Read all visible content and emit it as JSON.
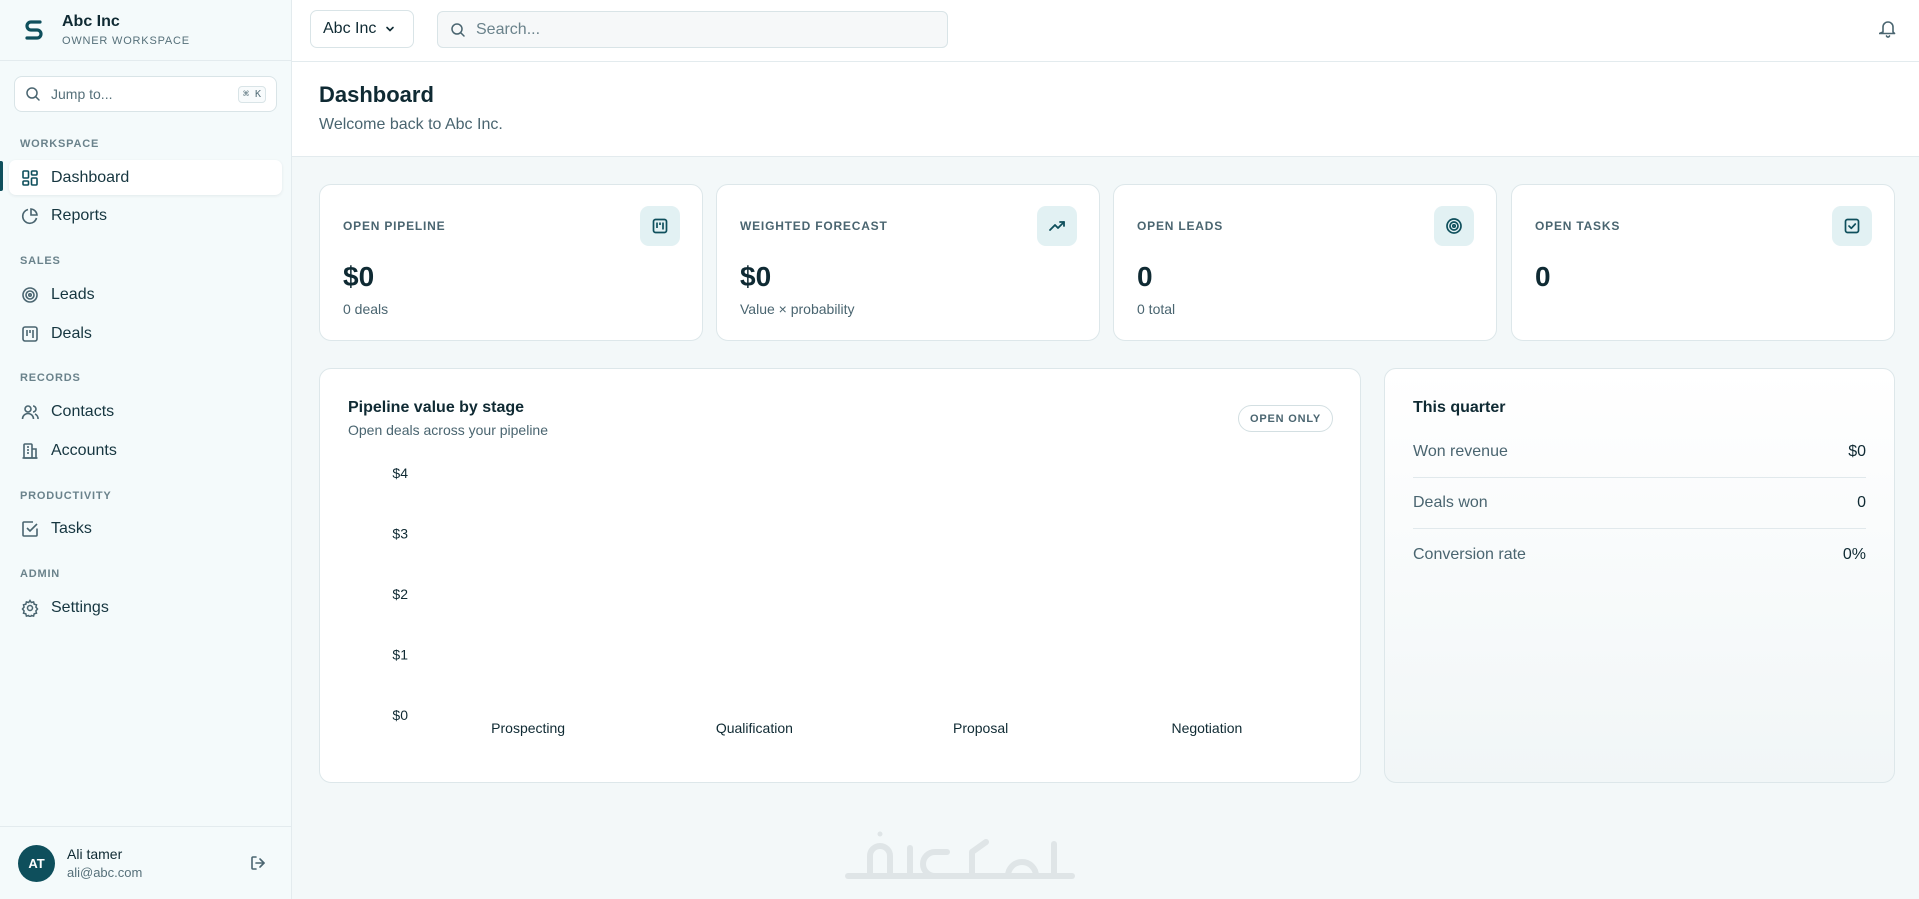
{
  "brand": {
    "name": "Abc Inc",
    "subtitle": "OWNER WORKSPACE"
  },
  "jump": {
    "placeholder": "Jump to...",
    "shortcut": "⌘ K"
  },
  "sidebar": {
    "sections": [
      {
        "label": "WORKSPACE",
        "items": [
          {
            "label": "Dashboard",
            "icon": "dashboard-icon",
            "active": true
          },
          {
            "label": "Reports",
            "icon": "pie-chart-icon"
          }
        ]
      },
      {
        "label": "SALES",
        "items": [
          {
            "label": "Leads",
            "icon": "target-icon"
          },
          {
            "label": "Deals",
            "icon": "kanban-icon"
          }
        ]
      },
      {
        "label": "RECORDS",
        "items": [
          {
            "label": "Contacts",
            "icon": "users-icon"
          },
          {
            "label": "Accounts",
            "icon": "building-icon"
          }
        ]
      },
      {
        "label": "PRODUCTIVITY",
        "items": [
          {
            "label": "Tasks",
            "icon": "checkbox-icon"
          }
        ]
      },
      {
        "label": "ADMIN",
        "items": [
          {
            "label": "Settings",
            "icon": "gear-icon"
          }
        ]
      }
    ]
  },
  "user": {
    "initials": "AT",
    "name": "Ali tamer",
    "email": "ali@abc.com"
  },
  "topbar": {
    "org": "Abc Inc",
    "search_placeholder": "Search..."
  },
  "page": {
    "title": "Dashboard",
    "subtitle": "Welcome back to Abc Inc."
  },
  "stats": [
    {
      "label": "OPEN PIPELINE",
      "value": "$0",
      "sub": "0 deals",
      "icon": "kanban-icon"
    },
    {
      "label": "WEIGHTED FORECAST",
      "value": "$0",
      "sub": "Value × probability",
      "icon": "trending-up-icon"
    },
    {
      "label": "OPEN LEADS",
      "value": "0",
      "sub": "0 total",
      "icon": "target-icon"
    },
    {
      "label": "OPEN TASKS",
      "value": "0",
      "sub": "",
      "icon": "checkbox-icon"
    }
  ],
  "pipeline_card": {
    "title": "Pipeline value by stage",
    "subtitle": "Open deals across your pipeline",
    "badge": "OPEN ONLY"
  },
  "chart_data": {
    "type": "bar",
    "categories": [
      "Prospecting",
      "Qualification",
      "Proposal",
      "Negotiation"
    ],
    "values": [
      0,
      0,
      0,
      0
    ],
    "y_ticks": [
      "$0",
      "$1",
      "$2",
      "$3",
      "$4"
    ],
    "ylim": [
      0,
      4
    ],
    "grid": false
  },
  "quarter": {
    "title": "This quarter",
    "rows": [
      {
        "label": "Won revenue",
        "value": "$0"
      },
      {
        "label": "Deals won",
        "value": "0"
      },
      {
        "label": "Conversion rate",
        "value": "0%"
      }
    ]
  },
  "colors": {
    "accent": "#0e4f5c",
    "icon_bg": "#e2f1f3",
    "page_bg": "#f3f8f9"
  }
}
